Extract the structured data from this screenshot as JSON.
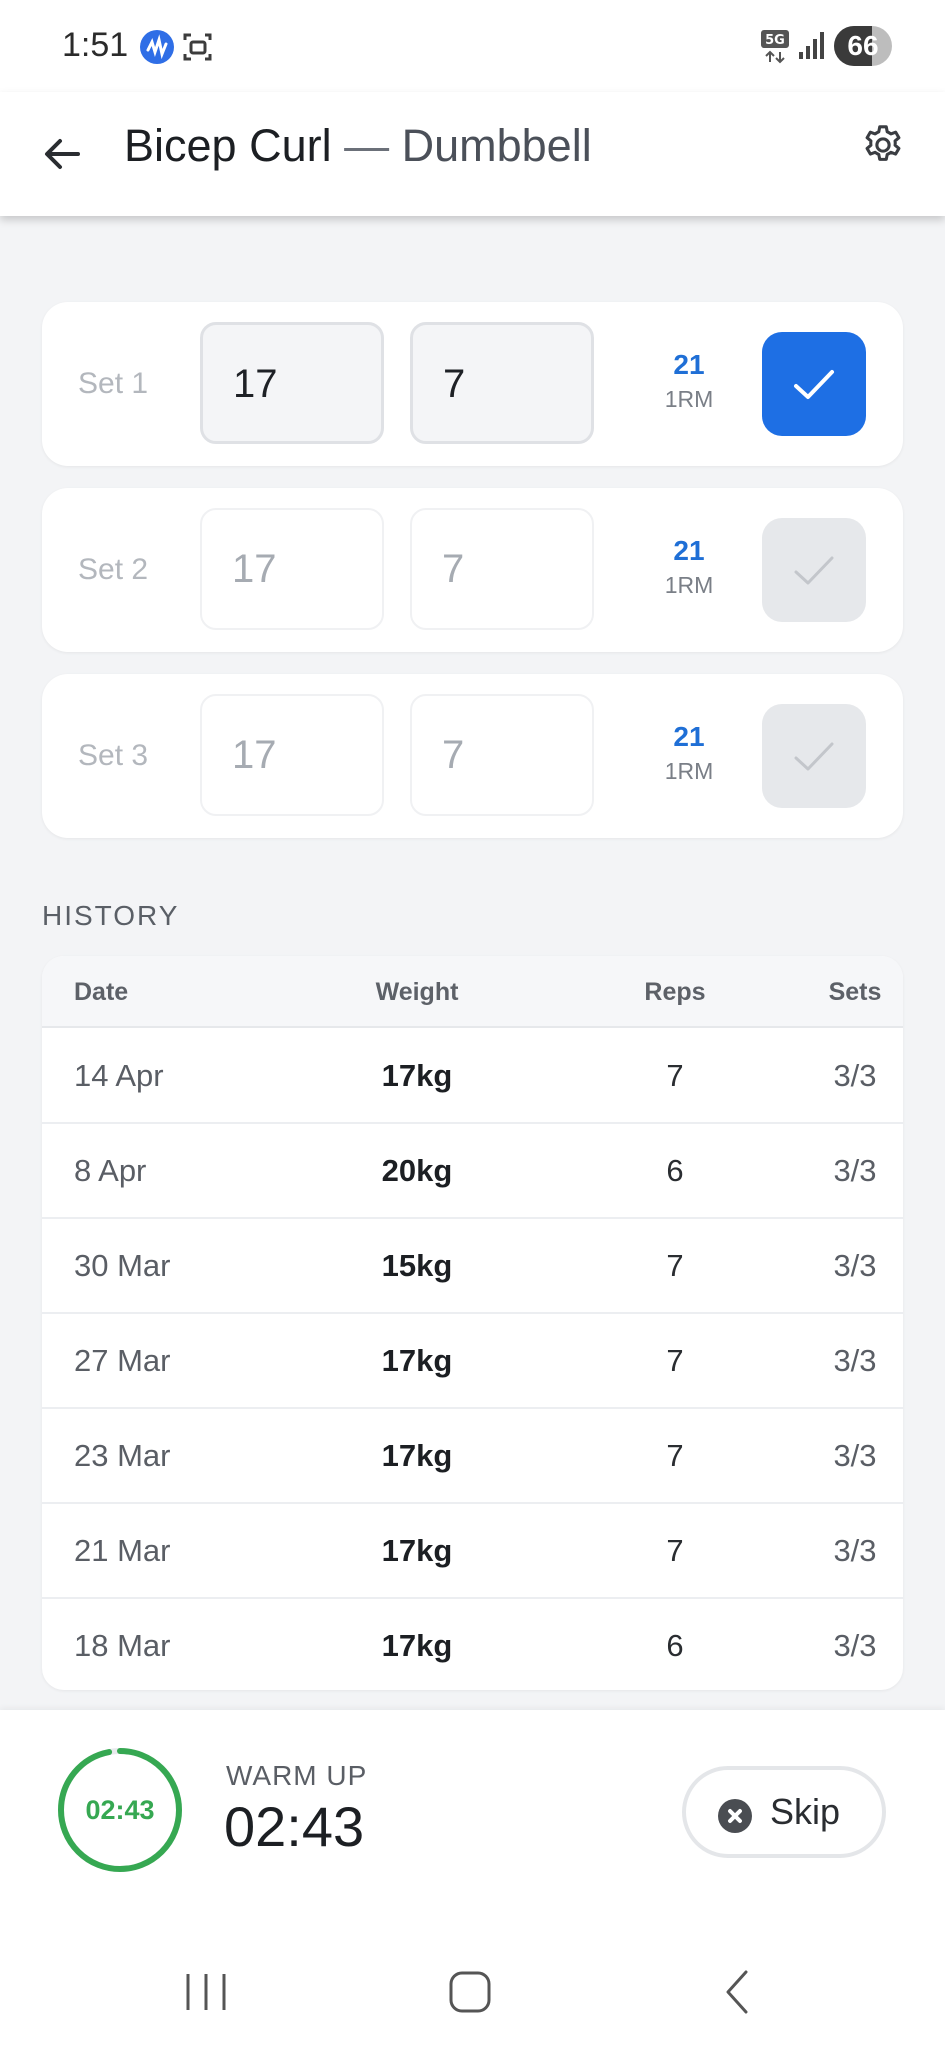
{
  "status_bar": {
    "time": "1:51",
    "battery": "66",
    "network": "5G"
  },
  "header": {
    "exercise": "Bicep Curl",
    "separator": "—",
    "equipment": "Dumbbell",
    "back_icon": "arrow-left-icon",
    "settings_icon": "gear-icon"
  },
  "sets": [
    {
      "label": "Set 1",
      "weight": "17",
      "reps": "7",
      "one_rm": "21",
      "one_rm_label": "1RM",
      "completed": true
    },
    {
      "label": "Set 2",
      "weight": "17",
      "reps": "7",
      "one_rm": "21",
      "one_rm_label": "1RM",
      "completed": false
    },
    {
      "label": "Set 3",
      "weight": "17",
      "reps": "7",
      "one_rm": "21",
      "one_rm_label": "1RM",
      "completed": false
    }
  ],
  "history": {
    "title": "HISTORY",
    "columns": [
      "Date",
      "Weight",
      "Reps",
      "Sets"
    ],
    "rows": [
      {
        "date": "14 Apr",
        "weight": "17kg",
        "reps": "7",
        "sets": "3/3"
      },
      {
        "date": "8 Apr",
        "weight": "20kg",
        "reps": "6",
        "sets": "3/3"
      },
      {
        "date": "30 Mar",
        "weight": "15kg",
        "reps": "7",
        "sets": "3/3"
      },
      {
        "date": "27 Mar",
        "weight": "17kg",
        "reps": "7",
        "sets": "3/3"
      },
      {
        "date": "23 Mar",
        "weight": "17kg",
        "reps": "7",
        "sets": "3/3"
      },
      {
        "date": "21 Mar",
        "weight": "17kg",
        "reps": "7",
        "sets": "3/3"
      },
      {
        "date": "18 Mar",
        "weight": "17kg",
        "reps": "6",
        "sets": "3/3"
      }
    ]
  },
  "timer": {
    "label": "WARM UP",
    "value": "02:43",
    "ring_text": "02:43",
    "remaining_fraction": 0.97,
    "skip_label": "Skip"
  },
  "colors": {
    "accent": "#1e6fe4",
    "timer_green": "#36a852",
    "one_rm_blue": "#1f6fd6"
  }
}
